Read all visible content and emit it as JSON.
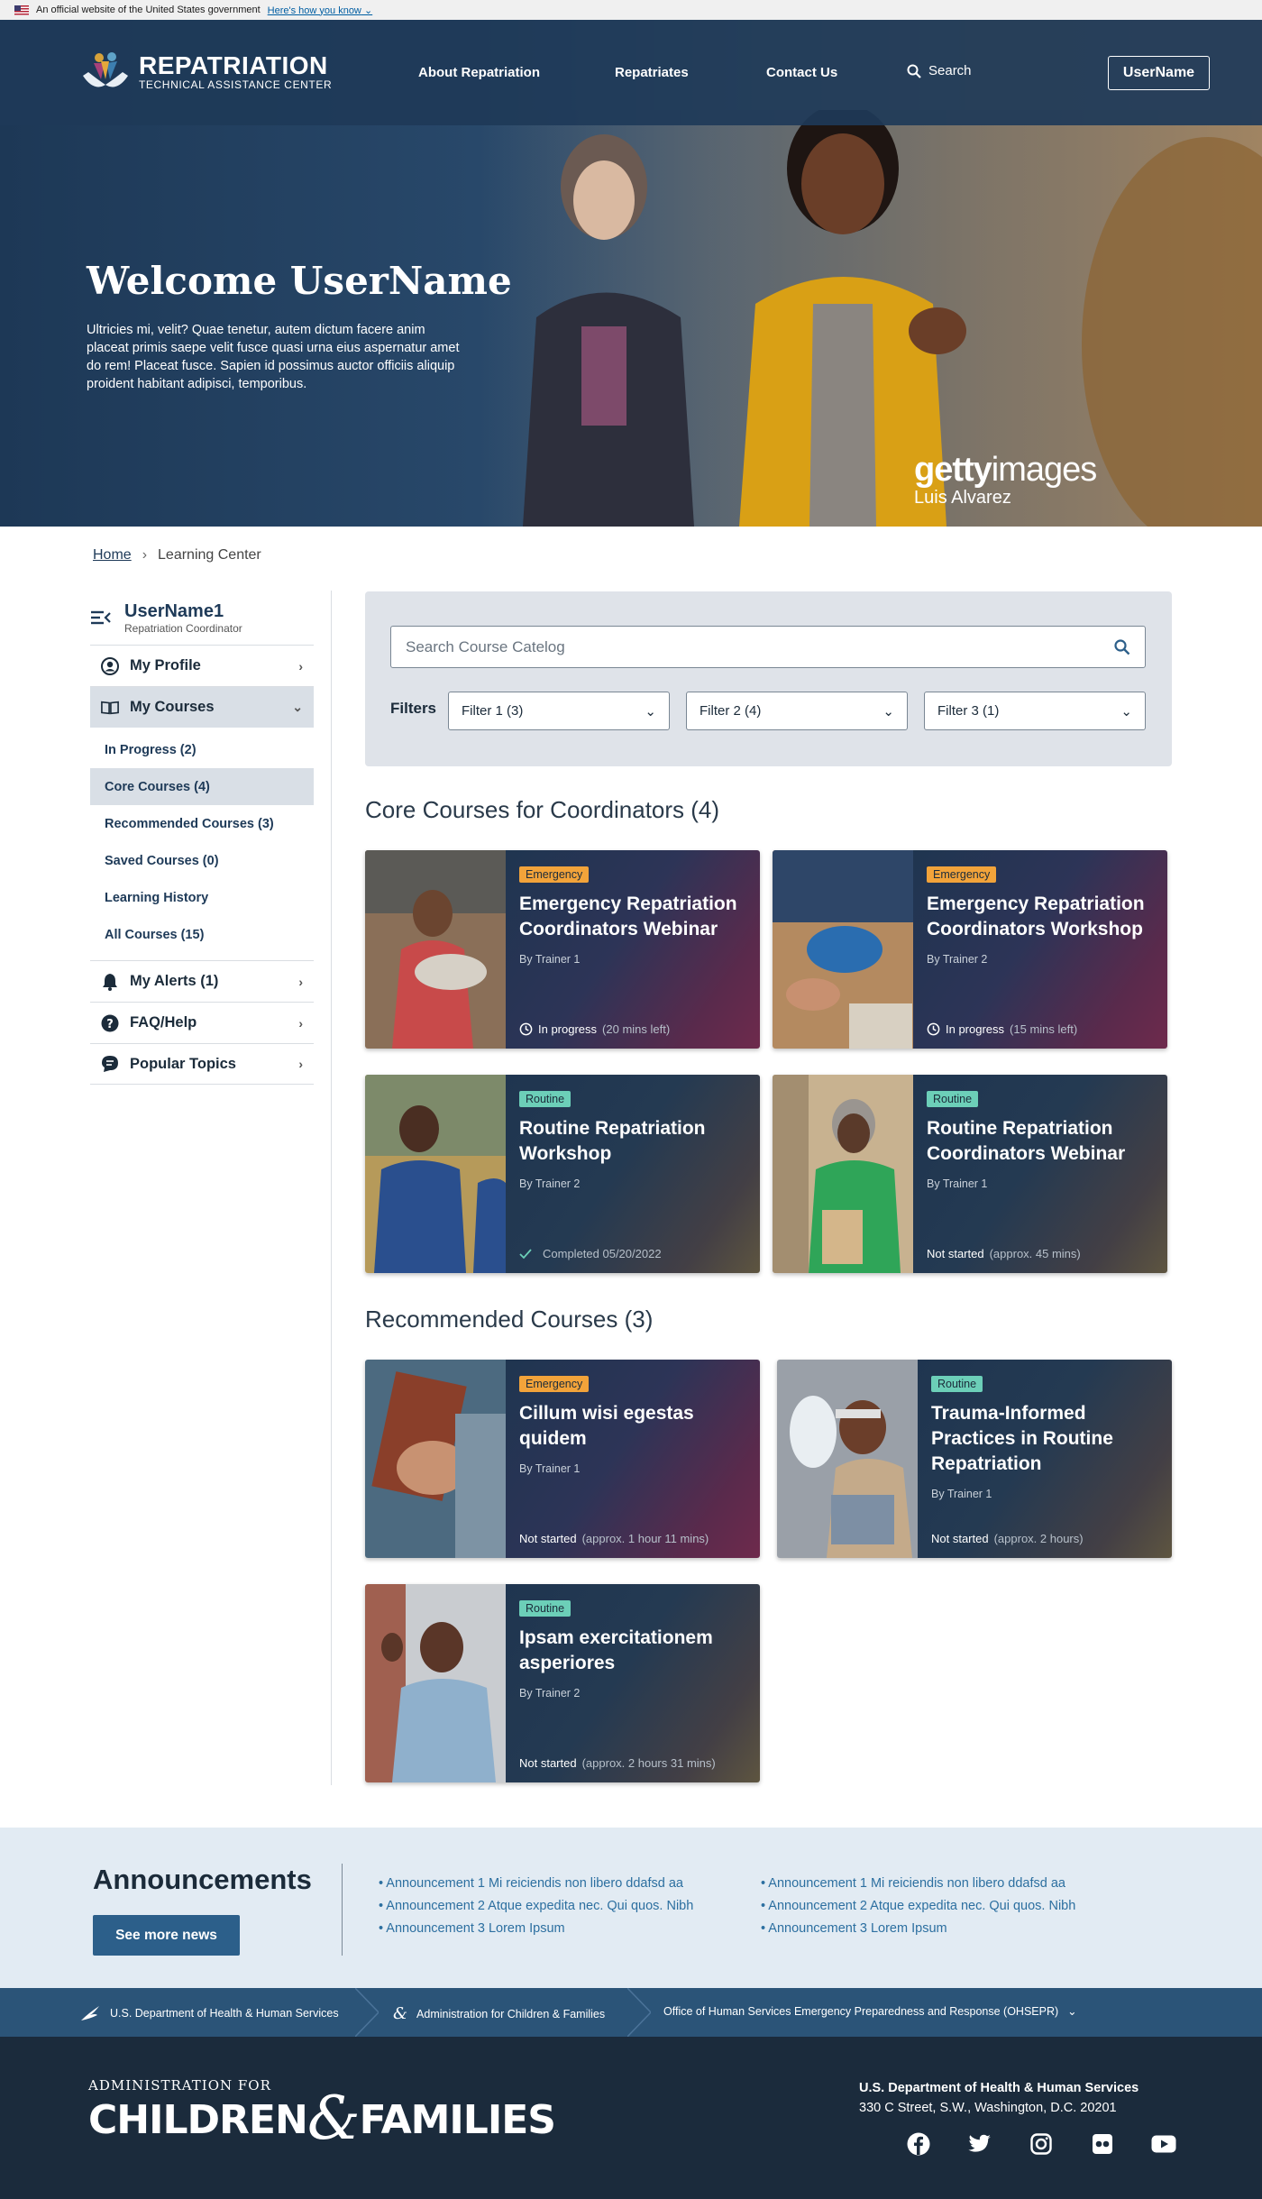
{
  "gov_banner": {
    "text": "An official website of the United States government",
    "link": "Here's how you know"
  },
  "header": {
    "logo_title": "REPATRIATION",
    "logo_subtitle": "TECHNICAL ASSISTANCE CENTER",
    "nav": [
      "About Repatriation",
      "Repatriates",
      "Contact Us"
    ],
    "search_label": "Search",
    "user_button": "UserName"
  },
  "hero": {
    "welcome": "Welcome UserName",
    "body": "Ultricies mi, velit? Quae tenetur, autem dictum facere anim placeat primis saepe velit fusce quasi urna eius aspernatur amet do rem! Placeat fusce. Sapien id possimus auctor officiis aliquip proident habitant adipisci, temporibus.",
    "watermark_brand_bold": "getty",
    "watermark_brand_light": "images",
    "watermark_credit": "Luis Alvarez"
  },
  "breadcrumb": {
    "home": "Home",
    "current": "Learning Center"
  },
  "sidebar": {
    "user_name": "UserName1",
    "user_role": "Repatriation Coordinator",
    "my_profile": "My Profile",
    "my_courses": "My Courses",
    "course_links": [
      "In Progress (2)",
      "Core Courses (4)",
      "Recommended Courses (3)",
      "Saved Courses (0)",
      "Learning History",
      "All Courses (15)"
    ],
    "my_alerts": "My Alerts (1)",
    "faq": "FAQ/Help",
    "popular": "Popular Topics"
  },
  "filters": {
    "search_placeholder": "Search Course Catelog",
    "label": "Filters",
    "options": [
      "Filter 1 (3)",
      "Filter 2 (4)",
      "Filter 3 (1)"
    ]
  },
  "core": {
    "heading": "Core Courses for Coordinators (4)",
    "cards": [
      {
        "tag": "Emergency",
        "title": "Emergency Repatriation Coordinators Webinar",
        "trainer": "By Trainer 1",
        "status": "In progress",
        "status_detail": "(20 mins left)"
      },
      {
        "tag": "Emergency",
        "title": "Emergency Repatriation Coordinators Workshop",
        "trainer": "By Trainer 2",
        "status": "In progress",
        "status_detail": "(15 mins left)"
      },
      {
        "tag": "Routine",
        "title": "Routine Repatriation Workshop",
        "trainer": "By Trainer 2",
        "status": "",
        "status_detail": "Completed 05/20/2022"
      },
      {
        "tag": "Routine",
        "title": "Routine Repatriation Coordinators Webinar",
        "trainer": "By Trainer 1",
        "status": "Not started",
        "status_detail": "(approx. 45 mins)"
      }
    ]
  },
  "recommended": {
    "heading": "Recommended Courses (3)",
    "cards": [
      {
        "tag": "Emergency",
        "title": "Cillum wisi egestas quidem",
        "trainer": "By Trainer 1",
        "status": "Not started",
        "status_detail": "(approx. 1 hour 11 mins)"
      },
      {
        "tag": "Routine",
        "title": "Trauma-Informed Practices in Routine Repatriation",
        "trainer": "By Trainer 1",
        "status": "Not started",
        "status_detail": "(approx. 2 hours)"
      },
      {
        "tag": "Routine",
        "title": "Ipsam exercitationem asperiores",
        "trainer": "By Trainer 2",
        "status": "Not started",
        "status_detail": "(approx. 2 hours 31 mins)"
      }
    ]
  },
  "announcements": {
    "title": "Announcements",
    "button": "See more news",
    "col1": [
      "• Announcement 1 Mi reiciendis non libero ddafsd aa",
      "• Announcement 2 Atque expedita nec. Qui quos. Nibh",
      "• Announcement 3 Lorem Ipsum"
    ],
    "col2": [
      "• Announcement 1 Mi reiciendis non libero ddafsd aa",
      "• Announcement 2 Atque expedita nec. Qui quos. Nibh",
      "• Announcement 3 Lorem Ipsum"
    ]
  },
  "agency_bar": [
    "U.S. Department of Health & Human Services",
    "Administration for Children & Families",
    "Office of Human Services Emergency Preparedness and Response (OHSEPR)"
  ],
  "footer": {
    "acf_top": "ADMINISTRATION FOR",
    "acf_left": "CHILDREN",
    "acf_amp": "&",
    "acf_right": "FAMILIES",
    "hhs_name": "U.S. Department of Health & Human Services",
    "hhs_address": "330 C Street, S.W., Washington, D.C. 20201",
    "social": [
      "facebook-icon",
      "twitter-icon",
      "instagram-icon",
      "flickr-icon",
      "youtube-icon"
    ]
  },
  "colors": {
    "navy": "#1e3a58",
    "emergency_tag": "#f2a33a",
    "routine_tag": "#6ccfb8",
    "footer": "#1b2b3c",
    "announce_bg": "#e2ebf3"
  }
}
